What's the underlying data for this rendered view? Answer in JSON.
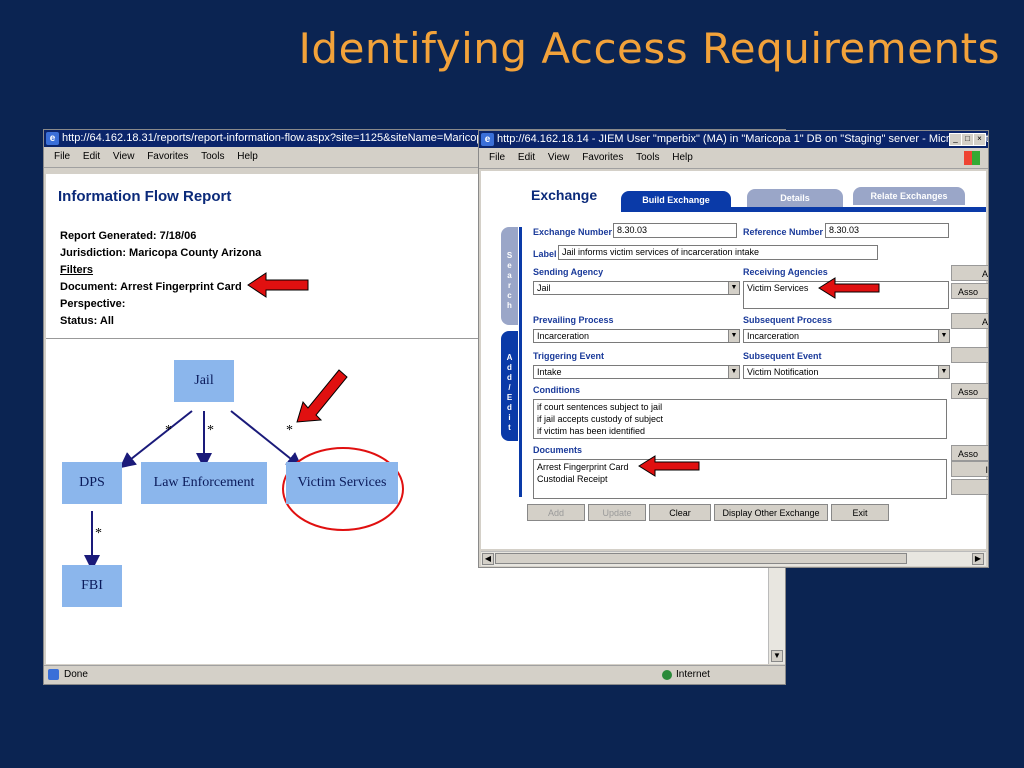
{
  "slide": {
    "title": "Identifying Access Requirements"
  },
  "report_window": {
    "url": "http://64.162.18.31/reports/report-information-flow.aspx?site=1125&siteName=Maricopa",
    "menu": [
      "File",
      "Edit",
      "View",
      "Favorites",
      "Tools",
      "Help"
    ],
    "heading": "Information Flow Report",
    "lines": [
      "Report Generated: 7/18/06",
      "Jurisdiction: Maricopa County Arizona",
      "Filters",
      "Document: Arrest Fingerprint Card",
      "Perspective:",
      "Status: All"
    ],
    "diagram": {
      "nodes": [
        "Jail",
        "DPS",
        "Law Enforcement",
        "Victim Services",
        "FBI"
      ],
      "edge_label": "*"
    },
    "status_text": "Done",
    "zone": "Internet"
  },
  "exchange_window": {
    "title": "http://64.162.18.14 - JIEM User \"mperbix\" (MA) in \"Maricopa 1\" DB on \"Staging\" server - Microsoft Intern...",
    "menu": [
      "File",
      "Edit",
      "View",
      "Favorites",
      "Tools",
      "Help"
    ],
    "heading": "Exchange",
    "tabs": [
      "Build Exchange",
      "Details",
      "Relate Exchanges"
    ],
    "side_tabs": [
      "Search",
      "Add/Edit"
    ],
    "fields": {
      "exchange_number_label": "Exchange Number",
      "exchange_number": "8.30.03",
      "reference_number_label": "Reference Number",
      "reference_number": "8.30.03",
      "label_label": "Label",
      "label": "Jail informs victim services of incarceration intake",
      "sending_agency_label": "Sending Agency",
      "sending_agency": "Jail",
      "receiving_agencies_label": "Receiving Agencies",
      "receiving_agencies": "Victim Services",
      "prevailing_process_label": "Prevailing Process",
      "prevailing_process": "Incarceration",
      "subsequent_process_label": "Subsequent Process",
      "subsequent_process": "Incarceration",
      "triggering_event_label": "Triggering Event",
      "triggering_event": "Intake",
      "subsequent_event_label": "Subsequent Event",
      "subsequent_event": "Victim Notification",
      "conditions_label": "Conditions",
      "conditions": [
        "if court sentences subject to jail",
        "if jail accepts custody of subject",
        "if victim has been identified"
      ],
      "documents_label": "Documents",
      "documents": [
        "Arrest Fingerprint Card",
        "Custodial Receipt"
      ]
    },
    "buttons": [
      "Add",
      "Update",
      "Clear",
      "Display Other Exchange",
      "Exit"
    ],
    "side_buttons": [
      "A",
      "Asso",
      "A",
      "",
      "Asso",
      "Asso",
      "I",
      ""
    ]
  },
  "colors": {
    "slide_bg": "#0b2452",
    "title": "#f2a23a",
    "node": "#8bb6ec",
    "arrow": "#e01010",
    "tab_active": "#0a3aa8"
  }
}
